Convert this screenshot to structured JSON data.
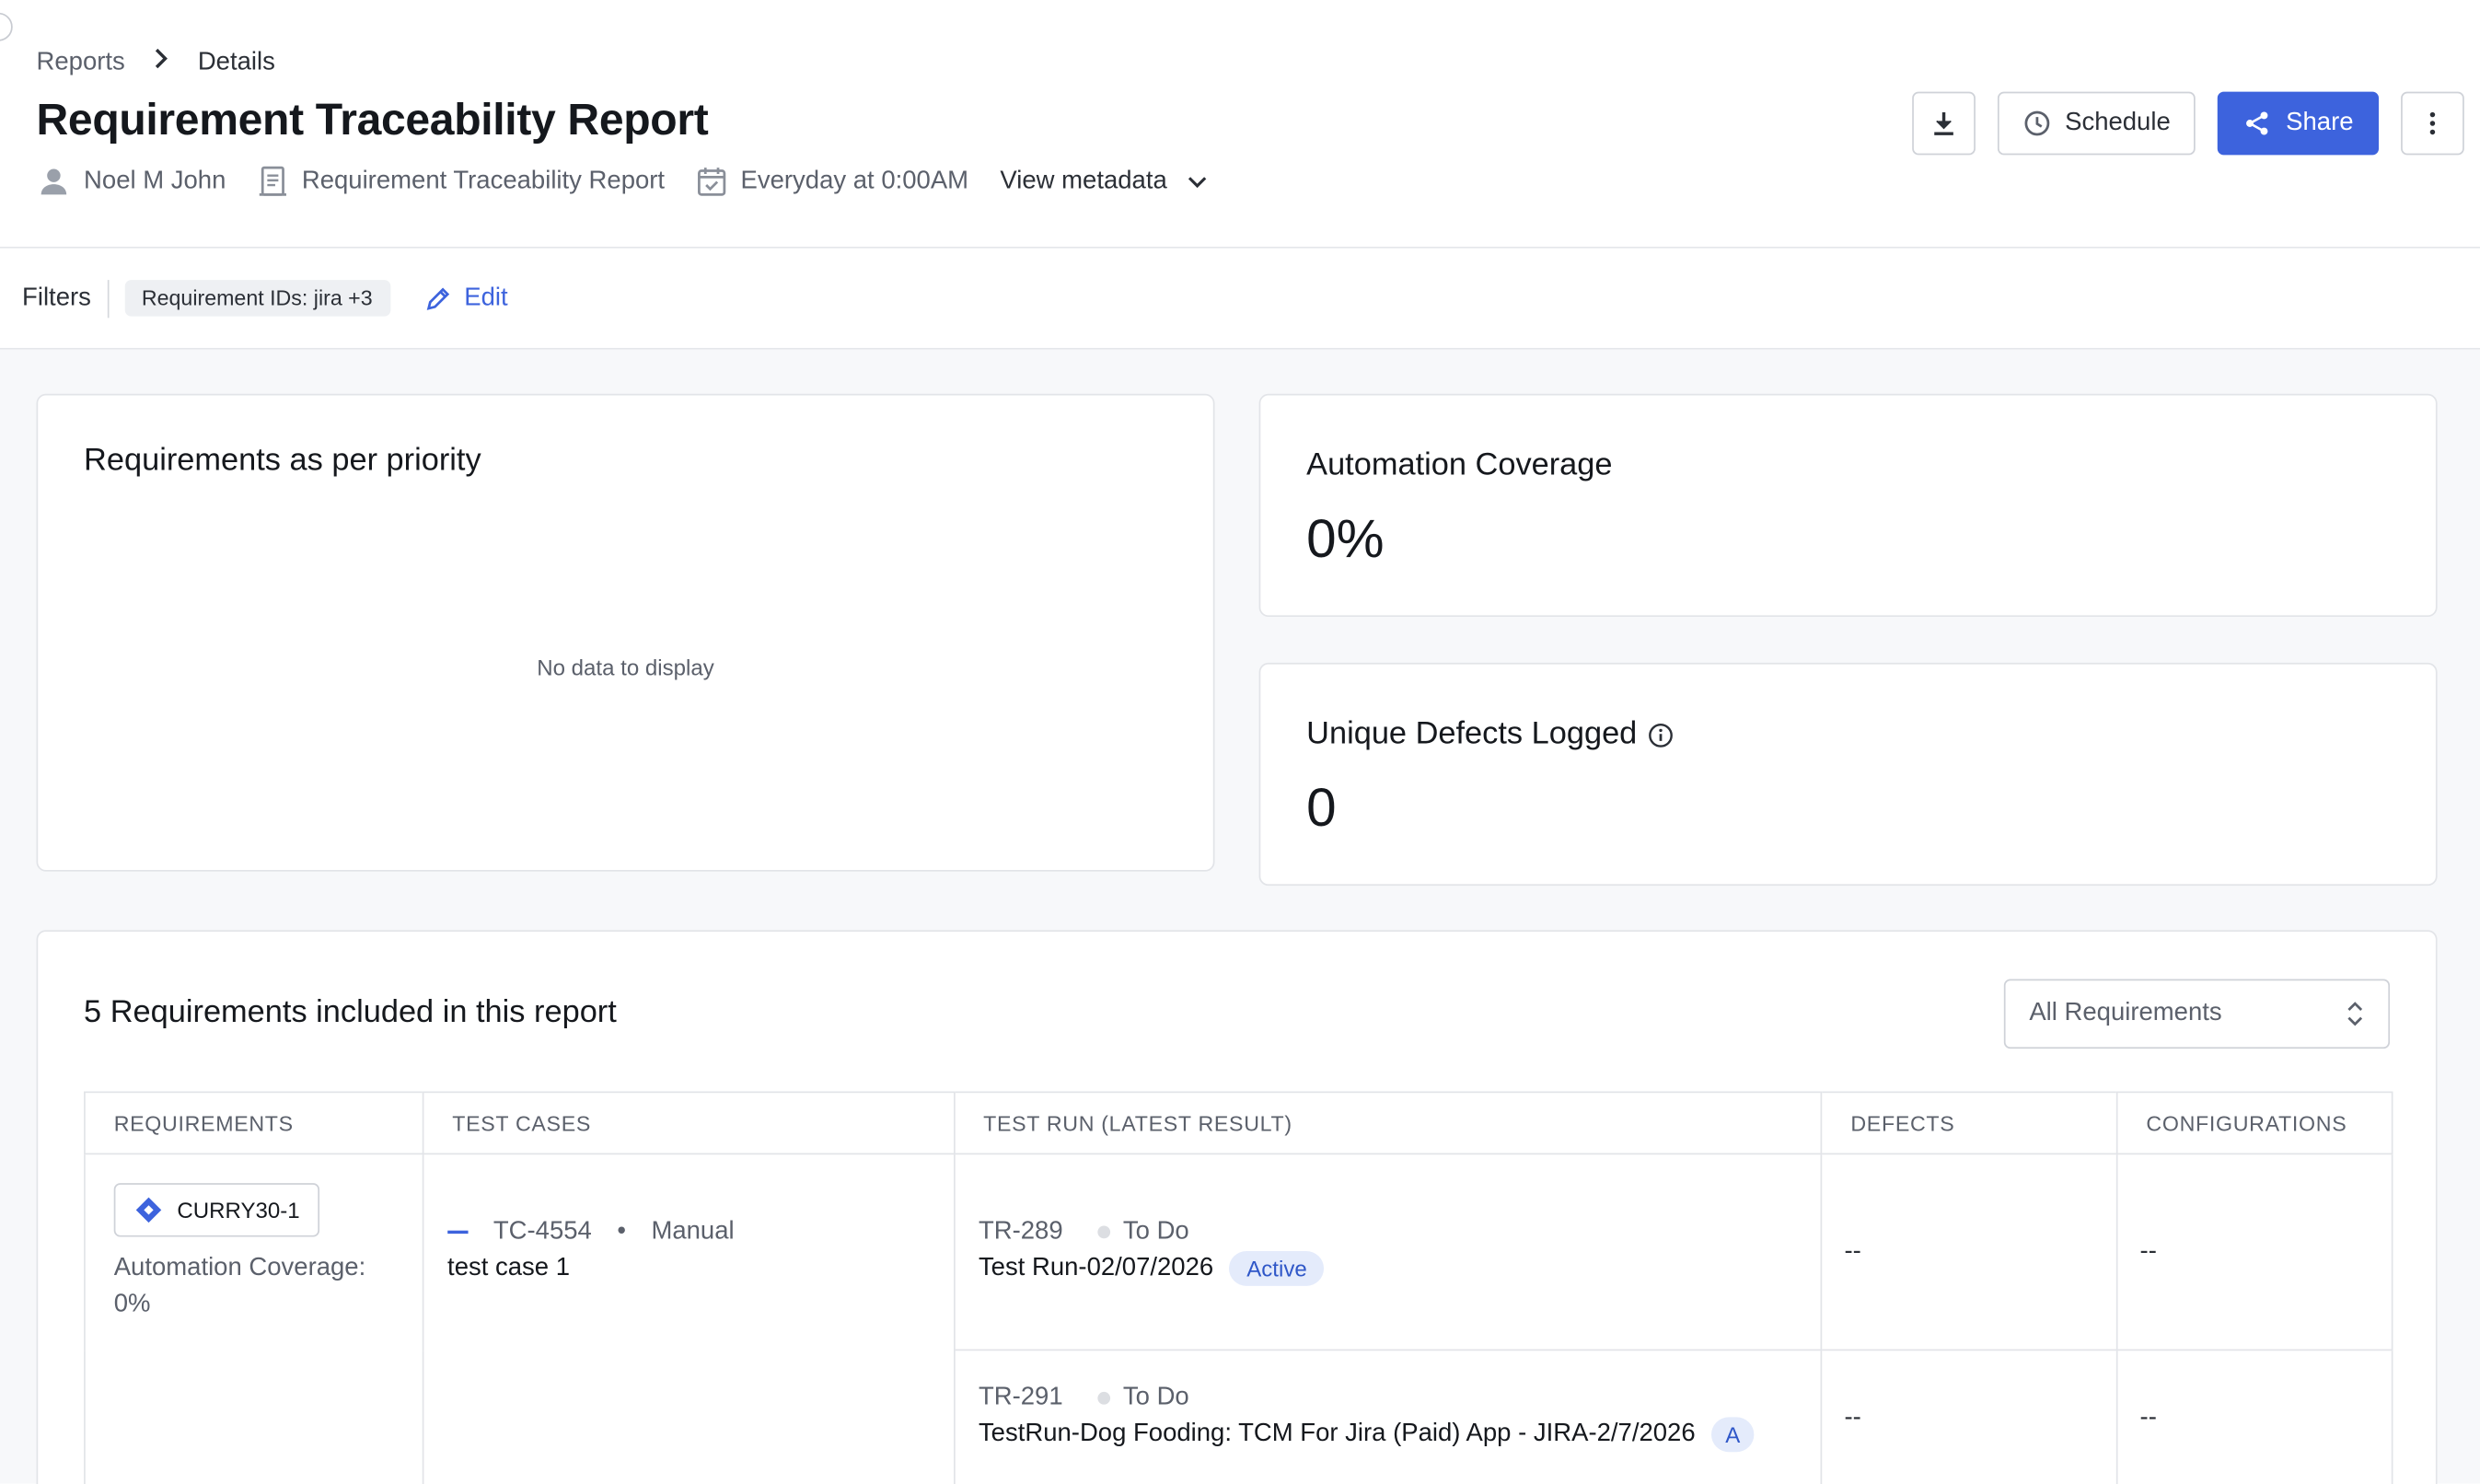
{
  "breadcrumb": {
    "root": "Reports",
    "current": "Details"
  },
  "page_title": "Requirement Traceability Report",
  "meta": {
    "owner": "Noel M John",
    "report_type": "Requirement Traceability Report",
    "schedule": "Everyday at 0:00AM",
    "view_metadata": "View metadata"
  },
  "actions": {
    "schedule": "Schedule",
    "share": "Share"
  },
  "filters": {
    "label": "Filters",
    "chip": "Requirement IDs: jira +3",
    "edit": "Edit"
  },
  "cards": {
    "priority": {
      "title": "Requirements as per priority",
      "empty": "No data to display"
    },
    "automation": {
      "title": "Automation Coverage",
      "value": "0%"
    },
    "defects": {
      "title": "Unique Defects Logged",
      "value": "0"
    }
  },
  "requirements": {
    "title": "5 Requirements included in this report",
    "filter_select": "All Requirements",
    "columns": [
      "REQUIREMENTS",
      "TEST CASES",
      "TEST RUN (LATEST RESULT)",
      "DEFECTS",
      "CONFIGURATIONS"
    ],
    "rows": [
      {
        "req_id": "CURRY30-1",
        "req_coverage_label": "Automation Coverage:",
        "req_coverage_value": "0%",
        "tc_id": "TC-4554",
        "tc_type": "Manual",
        "tc_name": "test case 1",
        "runs": [
          {
            "id": "TR-289",
            "status": "To Do",
            "name": "Test Run-02/07/2026",
            "badge": "Active",
            "defects": "--",
            "configs": "--"
          },
          {
            "id": "TR-291",
            "status": "To Do",
            "name": "TestRun-Dog Fooding: TCM For Jira (Paid) App - JIRA-2/7/2026",
            "badge": "A",
            "defects": "--",
            "configs": "--"
          }
        ]
      }
    ]
  },
  "colors": {
    "accent": "#3d63dd",
    "badge_bg": "#e4ebfb",
    "page_bg": "#f7f8fa"
  }
}
